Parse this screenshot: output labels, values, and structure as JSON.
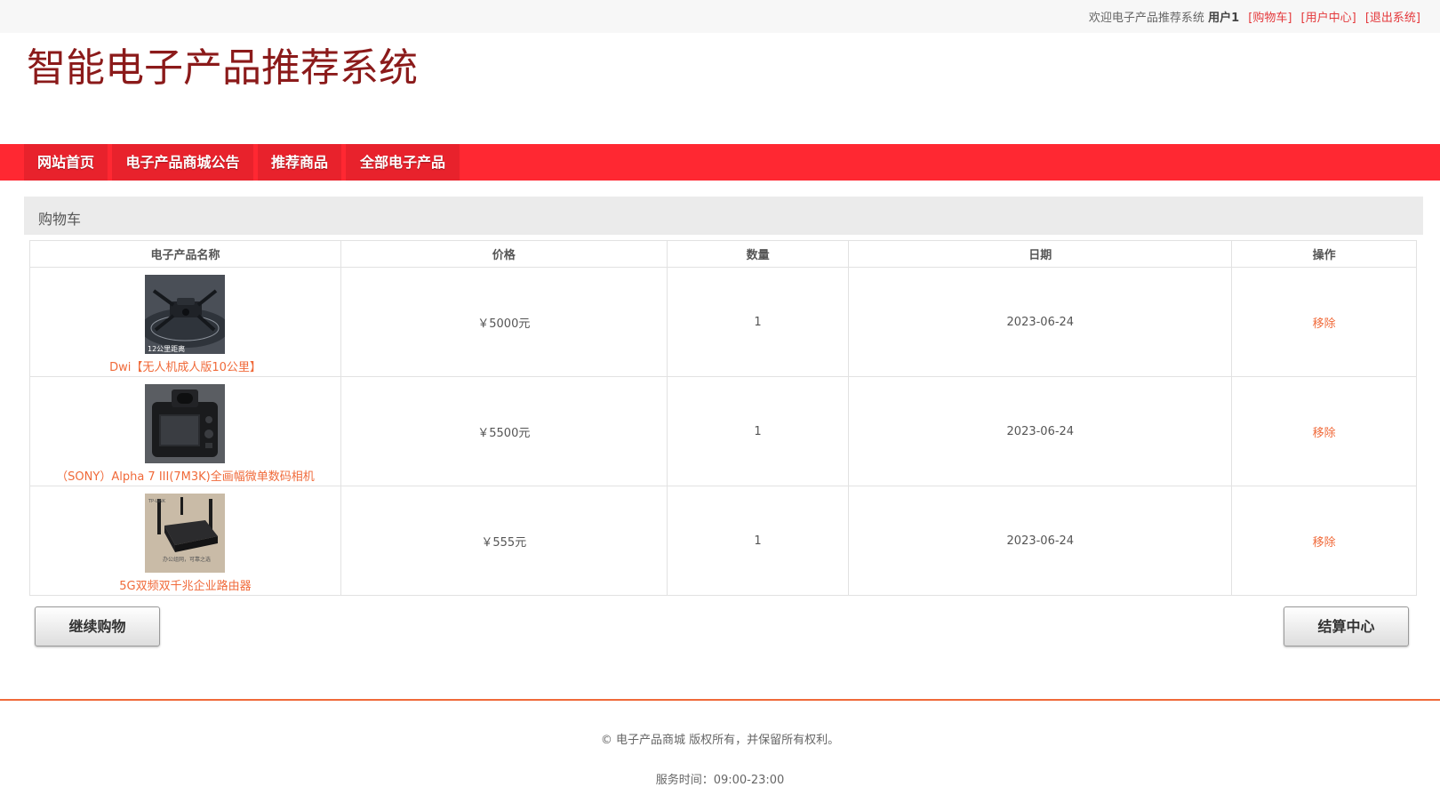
{
  "topbar": {
    "welcome": "欢迎电子产品推荐系统",
    "username": "用户1",
    "links": [
      "[购物车]",
      "[用户中心]",
      "[退出系统]"
    ]
  },
  "site": {
    "title": "智能电子产品推荐系统"
  },
  "nav": {
    "items": [
      "网站首页",
      "电子产品商城公告",
      "推荐商品",
      "全部电子产品"
    ]
  },
  "cart": {
    "heading": "购物车",
    "columns": [
      "电子产品名称",
      "价格",
      "数量",
      "日期",
      "操作"
    ],
    "rows": [
      {
        "name": "Dwi【无人机成人版10公里】",
        "price": "￥5000元",
        "qty": "1",
        "date": "2023-06-24",
        "action": "移除",
        "thumb_caption": "12公里距离"
      },
      {
        "name": "（SONY）Alpha 7 III(7M3K)全画幅微单数码相机",
        "price": "￥5500元",
        "qty": "1",
        "date": "2023-06-24",
        "action": "移除"
      },
      {
        "name": "5G双频双千兆企业路由器",
        "price": "￥555元",
        "qty": "1",
        "date": "2023-06-24",
        "action": "移除",
        "thumb_caption": "办公组网，可靠之选",
        "thumb_brand": "TP-LINK"
      }
    ],
    "continue_label": "继续购物",
    "checkout_label": "结算中心"
  },
  "footer": {
    "copyright": "© 电子产品商城 版权所有，并保留所有权利。",
    "service_time": "服务时间：09:00-23:00"
  },
  "colors": {
    "nav_bg": "#ff2832",
    "title": "#8b1a1a",
    "link": "#f06a3a",
    "accent_line": "#f06a3a"
  }
}
